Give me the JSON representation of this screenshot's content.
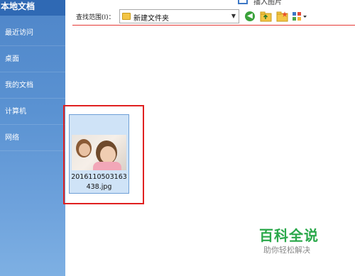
{
  "sidebar": {
    "header": "本地文档",
    "items": [
      {
        "label": "最近访问"
      },
      {
        "label": "桌面"
      },
      {
        "label": "我的文档"
      },
      {
        "label": "计算机"
      },
      {
        "label": "网络"
      }
    ]
  },
  "window": {
    "title": "插入图片"
  },
  "toolbar": {
    "lookin_label": "查找范围(I)：",
    "current_folder": "新建文件夹",
    "icons": [
      "back-icon",
      "up-folder-icon",
      "new-folder-icon",
      "views-menu-icon"
    ],
    "back_icon_color": "#3aa13a"
  },
  "files": [
    {
      "name": "2016110503163438.jpg",
      "selected": true,
      "icon": "photo-thumbnail"
    }
  ],
  "watermark": {
    "logo": "百科全说",
    "tagline": "助你轻松解决",
    "color": "#2aa84a"
  },
  "colors": {
    "sidebar_header": "#2f69b4",
    "sidebar": "#5a92d2",
    "selection_fill": "#cfe3f7",
    "highlight_border": "#e02020"
  }
}
